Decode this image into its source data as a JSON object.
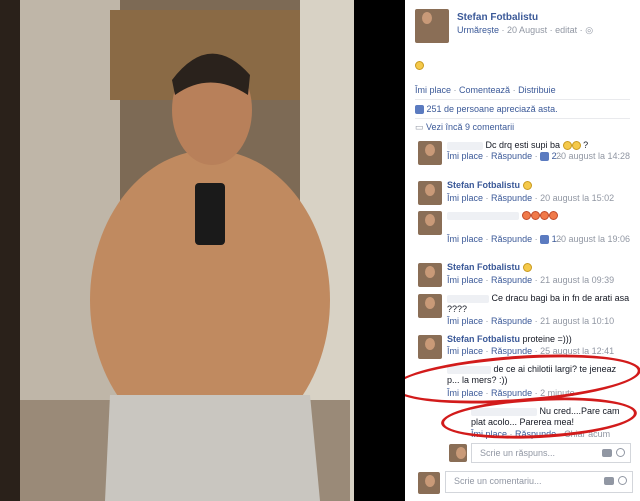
{
  "post": {
    "author": "Stefan Fotbalistu",
    "follow": "Urmărește",
    "date": "20 August",
    "edited": "editat",
    "sep": "·",
    "body_emoji": "smiley",
    "actions": {
      "like": "Îmi place",
      "comment": "Comentează",
      "share": "Distribuie"
    },
    "likes_text": "251 de persoane apreciază asta.",
    "more_comments": "Vezi încă 9 comentarii"
  },
  "comments": [
    {
      "text": "Dc drq esti supi ba",
      "like": "Îmi place",
      "reply": "Răspunde",
      "likes": "2",
      "time": "20 august la 14:28"
    },
    {
      "author": "Stefan Fotbalistu",
      "like": "Îmi place",
      "reply": "Răspunde",
      "time": "20 august la 15:02"
    },
    {
      "like": "Îmi place",
      "reply": "Răspunde",
      "likes": "1",
      "time": "20 august la 19:06"
    },
    {
      "author": "Stefan Fotbalistu",
      "like": "Îmi place",
      "reply": "Răspunde",
      "time": "21 august la 09:39"
    },
    {
      "text": "Ce dracu bagi ba in fn de arati asa ????",
      "like": "Îmi place",
      "reply": "Răspunde",
      "time": "21 august la 10:10"
    },
    {
      "author": "Stefan Fotbalistu",
      "text": "proteine =)))",
      "like": "Îmi place",
      "reply": "Răspunde",
      "time": "25 august la 12:41"
    },
    {
      "text": "de ce ai chilotii largi? te jeneaz p... la mers? :))",
      "like": "Îmi place",
      "reply": "Răspunde",
      "time": "2 minute"
    },
    {
      "text": "Nu cred....Pare cam plat acolo... Parerea mea!",
      "like": "Îmi place",
      "reply": "Răspunde",
      "time": "Chiar acum"
    }
  ],
  "reply_placeholder": "Scrie un răspuns...",
  "comment_placeholder": "Scrie un comentariu..."
}
